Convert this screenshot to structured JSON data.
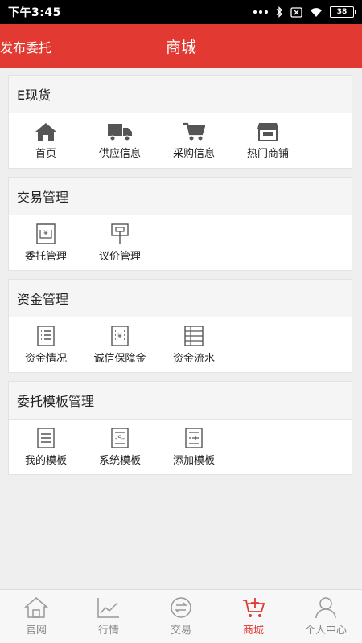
{
  "status_bar": {
    "time": "下午3:45",
    "battery": "38"
  },
  "header": {
    "publish_label": "发布委托",
    "title": "商城"
  },
  "sections": [
    {
      "title": "E现货",
      "items": [
        {
          "label": "首页",
          "icon": "home-icon"
        },
        {
          "label": "供应信息",
          "icon": "truck-icon"
        },
        {
          "label": "采购信息",
          "icon": "cart-icon"
        },
        {
          "label": "热门商铺",
          "icon": "shop-icon"
        }
      ]
    },
    {
      "title": "交易管理",
      "items": [
        {
          "label": "委托管理",
          "icon": "yen-document-icon"
        },
        {
          "label": "议价管理",
          "icon": "sign-board-icon"
        }
      ]
    },
    {
      "title": "资金管理",
      "items": [
        {
          "label": "资金情况",
          "icon": "list-document-icon"
        },
        {
          "label": "诚信保障金",
          "icon": "yen-list-icon"
        },
        {
          "label": "资金流水",
          "icon": "ledger-icon"
        }
      ]
    },
    {
      "title": "委托模板管理",
      "items": [
        {
          "label": "我的模板",
          "icon": "template-icon"
        },
        {
          "label": "系统模板",
          "icon": "s-template-icon"
        },
        {
          "label": "添加模板",
          "icon": "add-template-icon"
        }
      ]
    }
  ],
  "tabbar": [
    {
      "label": "官网",
      "icon": "home-outline-icon",
      "active": false
    },
    {
      "label": "行情",
      "icon": "chart-icon",
      "active": false
    },
    {
      "label": "交易",
      "icon": "exchange-icon",
      "active": false
    },
    {
      "label": "商城",
      "icon": "mall-cart-icon",
      "active": true
    },
    {
      "label": "个人中心",
      "icon": "person-icon",
      "active": false
    }
  ],
  "colors": {
    "accent": "#e23a32",
    "icon_gray": "#555555",
    "tab_inactive": "#888888"
  }
}
